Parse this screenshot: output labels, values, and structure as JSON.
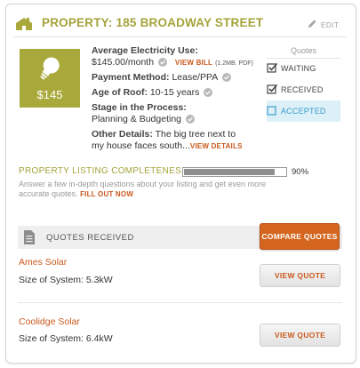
{
  "header": {
    "title": "PROPERTY: 185 BROADWAY STREET",
    "edit_label": "EDIT"
  },
  "tile": {
    "price": "$145"
  },
  "details": {
    "electricity_label": "Average Electricity Use:",
    "electricity_value": "$145.00/month",
    "view_bill_label": "VIEW BILL",
    "bill_info": "(1.2MB. PDF)",
    "payment_label": "Payment Method:",
    "payment_value": "Lease/PPA",
    "roof_label": "Age of Roof:",
    "roof_value": "10-15 years",
    "stage_label": "Stage in the Process:",
    "stage_value": "Planning & Budgeting",
    "other_label": "Other Details:",
    "other_line1": "The big tree next to",
    "other_line2": "my house faces south...",
    "view_details_label": "VIEW DETAILS"
  },
  "quotes_status": {
    "title": "Quotes",
    "items": [
      {
        "label": "WAITING",
        "checked": true
      },
      {
        "label": "RECEIVED",
        "checked": true
      },
      {
        "label": "ACCEPTED",
        "checked": false
      }
    ]
  },
  "completeness": {
    "title": "PROPERTY LISTING COMPLETENESS",
    "percent": 90,
    "percent_label": "90%",
    "desc": "Answer a few in-depth questions about your listing and get even more accurate quotes.",
    "fill_out_label": "FILL OUT NOW"
  },
  "quotes_received": {
    "title": "QUOTES RECEIVED",
    "compare_label": "COMPARE QUOTES",
    "quotes": [
      {
        "name": "Ames Solar",
        "size_label": "Size of System:",
        "size_value": "5.3kW",
        "button": "VIEW QUOTE"
      },
      {
        "name": "Coolidge Solar",
        "size_label": "Size of System:",
        "size_value": "6.4kW",
        "button": "VIEW QUOTE"
      }
    ]
  },
  "colors": {
    "accent_olive": "#a9a93b",
    "accent_orange": "#d4651f",
    "active_blue": "#3a9cc9"
  }
}
